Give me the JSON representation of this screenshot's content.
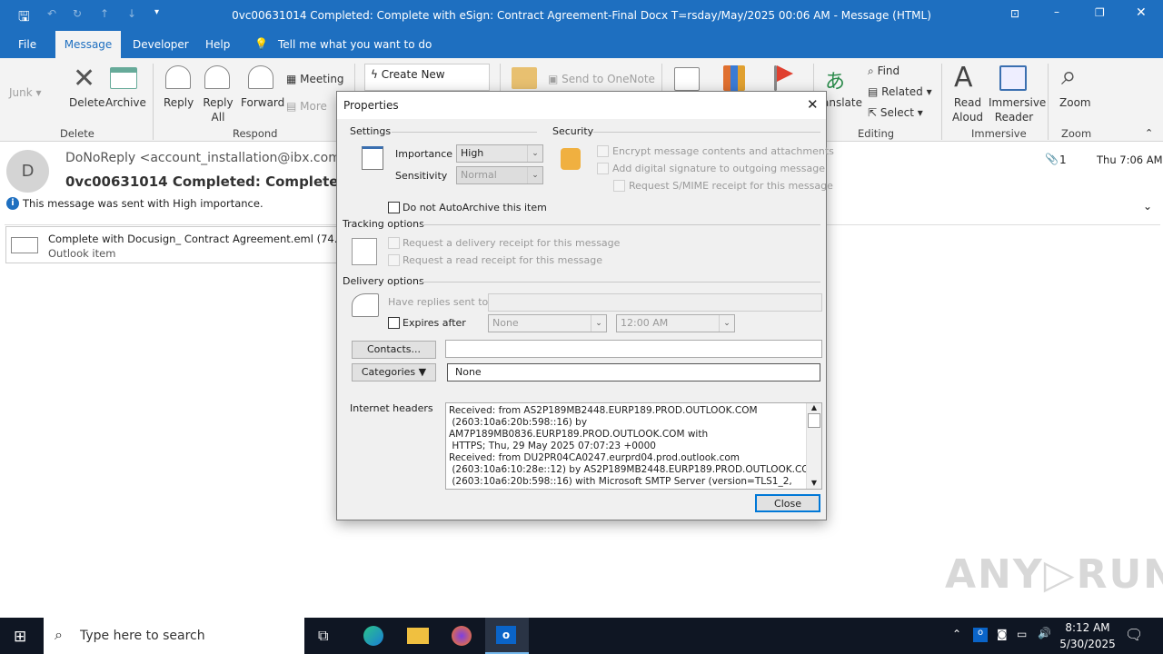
{
  "window": {
    "title": "0vc00631014 Completed: Complete with eSign: Contract Agreement-Final Docx T=rsday/May/2025 00:06 AM  -  Message (HTML)"
  },
  "tabs": [
    {
      "label": "File"
    },
    {
      "label": "Message"
    },
    {
      "label": "Developer"
    },
    {
      "label": "Help"
    },
    {
      "label": "Tell me what you want to do"
    }
  ],
  "ribbon": {
    "junk": "Junk",
    "delete": "Delete",
    "archive": "Archive",
    "reply": "Reply",
    "reply_all": "Reply All",
    "forward": "Forward",
    "meeting": "Meeting",
    "more": "More",
    "create_new": "Create New",
    "send_onenote": "Send to OneNote",
    "translate": "anslate",
    "find": "Find",
    "related": "Related",
    "select": "Select",
    "read_aloud": "Read Aloud",
    "immersive_reader": "Immersive Reader",
    "zoom": "Zoom",
    "groups": {
      "delete": "Delete",
      "respond": "Respond",
      "editing": "Editing",
      "immersive": "Immersive",
      "zoom": "Zoom"
    }
  },
  "message": {
    "avatar_letter": "D",
    "from": "DoNoReply <account_installation@ibx.com>",
    "subject": "0vc00631014 Completed: Complete with eSign",
    "importance_note": "This message was sent with High importance.",
    "attachment_count": "1",
    "time": "Thu 7:06 AM",
    "attachment": {
      "name": "Complete with Docusign_ Contract Agreement.eml (74.5 KB)",
      "type": "Outlook item"
    }
  },
  "dialog": {
    "title": "Properties",
    "settings_label": "Settings",
    "importance_label": "Importance",
    "importance_value": "High",
    "sensitivity_label": "Sensitivity",
    "sensitivity_value": "Normal",
    "security_label": "Security",
    "encrypt": "Encrypt message contents and attachments",
    "digital_sig": "Add digital signature to outgoing message",
    "smime": "Request S/MIME receipt for this message",
    "autoarchive": "Do not AutoArchive this item",
    "tracking_label": "Tracking options",
    "delivery_receipt": "Request a delivery receipt for this message",
    "read_receipt": "Request a read receipt for this message",
    "delivery_label": "Delivery options",
    "replies_to": "Have replies sent to",
    "expires": "Expires after",
    "expires_date": "None",
    "expires_time": "12:00 AM",
    "contacts_btn": "Contacts...",
    "categories_btn": "Categories",
    "categories_value": "None",
    "headers_label": "Internet headers",
    "headers_lines": [
      "Received: from AS2P189MB2448.EURP189.PROD.OUTLOOK.COM",
      " (2603:10a6:20b:598::16) by",
      "AM7P189MB0836.EURP189.PROD.OUTLOOK.COM with",
      " HTTPS; Thu, 29 May 2025 07:07:23 +0000",
      "Received: from DU2PR04CA0247.eurprd04.prod.outlook.com",
      " (2603:10a6:10:28e::12) by AS2P189MB2448.EURP189.PROD.OUTLOOK.COM",
      " (2603:10a6:20b:598::16) with Microsoft SMTP Server (version=TLS1_2,"
    ],
    "close_btn": "Close"
  },
  "taskbar": {
    "search_placeholder": "Type here to search",
    "time": "8:12 AM",
    "date": "5/30/2025"
  },
  "watermark": "ANY RUN",
  "colors": {
    "accent": "#1e6fc0",
    "taskbar": "#0f1623"
  }
}
